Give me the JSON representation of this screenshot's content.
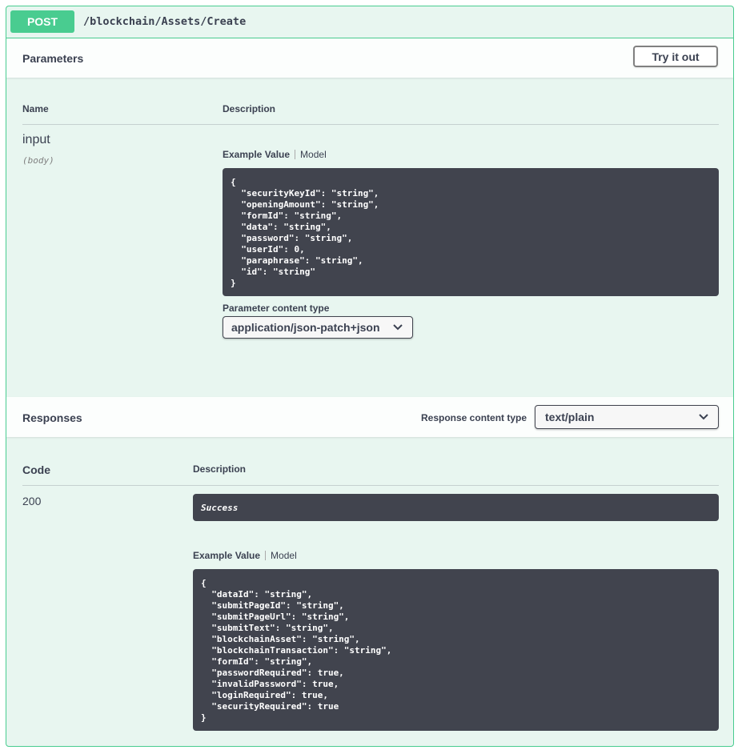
{
  "operation": {
    "method": "POST",
    "path": "/blockchain/Assets/Create"
  },
  "parameters": {
    "title": "Parameters",
    "try_button": "Try it out",
    "col_name": "Name",
    "col_description": "Description",
    "param_name": "input",
    "param_in": "(body)",
    "tab_example": "Example Value",
    "tab_model": "Model",
    "example": "{\n  \"securityKeyId\": \"string\",\n  \"openingAmount\": \"string\",\n  \"formId\": \"string\",\n  \"data\": \"string\",\n  \"password\": \"string\",\n  \"userId\": 0,\n  \"paraphrase\": \"string\",\n  \"id\": \"string\"\n}",
    "content_type_label": "Parameter content type",
    "content_type_value": "application/json-patch+json"
  },
  "responses": {
    "title": "Responses",
    "content_type_label": "Response content type",
    "content_type_value": "text/plain",
    "col_code": "Code",
    "col_description": "Description",
    "code": "200",
    "description": "Success",
    "tab_example": "Example Value",
    "tab_model": "Model",
    "example": "{\n  \"dataId\": \"string\",\n  \"submitPageId\": \"string\",\n  \"submitPageUrl\": \"string\",\n  \"submitText\": \"string\",\n  \"blockchainAsset\": \"string\",\n  \"blockchainTransaction\": \"string\",\n  \"formId\": \"string\",\n  \"passwordRequired\": true,\n  \"invalidPassword\": true,\n  \"loginRequired\": true,\n  \"securityRequired\": true\n}"
  },
  "icons": {
    "dropdown": "chevron-down-icon"
  },
  "colors": {
    "post": "#49cc90",
    "post_bg": "#e8f6f0",
    "code_bg": "#41444e"
  }
}
